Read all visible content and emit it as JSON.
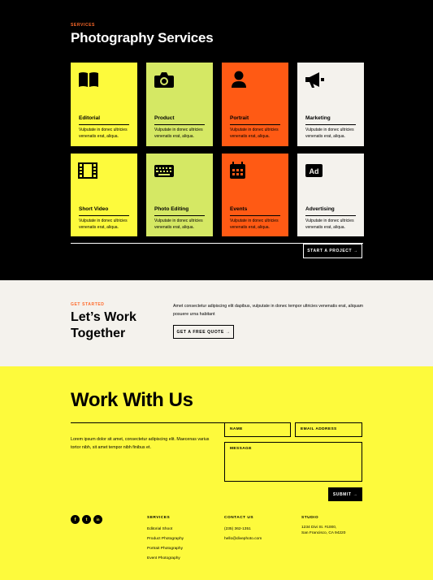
{
  "services": {
    "eyebrow": "SERVICES",
    "title": "Photography Services",
    "cards": [
      {
        "title": "Editorial",
        "desc": "Vulputate in donec ultricies venenatis erat, aliqua.",
        "icon": "book-icon",
        "color": "#fdfa3c"
      },
      {
        "title": "Product",
        "desc": "Vulputate in donec ultricies venenatis erat, aliqua.",
        "icon": "camera-icon",
        "color": "#d5e864"
      },
      {
        "title": "Portrait",
        "desc": "Vulputate in donec ultricies venenatis erat, aliqua.",
        "icon": "user-icon",
        "color": "#ff5a14"
      },
      {
        "title": "Marketing",
        "desc": "Vulputate in donec ultricies venenatis erat, aliqua.",
        "icon": "megaphone-icon",
        "color": "#f4f2ed"
      },
      {
        "title": "Short Video",
        "desc": "Vulputate in donec ultricies venenatis erat, aliqua.",
        "icon": "film-icon",
        "color": "#fdfa3c"
      },
      {
        "title": "Photo Editing",
        "desc": "Vulputate in donec ultricies venenatis erat, aliqua.",
        "icon": "keyboard-icon",
        "color": "#d5e864"
      },
      {
        "title": "Events",
        "desc": "Vulputate in donec ultricies venenatis erat, aliqua.",
        "icon": "calendar-icon",
        "color": "#ff5a14"
      },
      {
        "title": "Advertising",
        "desc": "Vulputate in donec ultricies venenatis erat, aliqua.",
        "icon": "ad-icon",
        "color": "#f4f2ed"
      }
    ],
    "cta_label": "START A PROJECT →"
  },
  "get_started": {
    "eyebrow": "GET STARTED",
    "title": "Let’s Work Together",
    "text": "Amet consectetur adipiscing elit dapibus, vulputate in donec tempor ultricies venenatis erat, aliquam posuere urna habitant",
    "button_label": "GET A FREE QUOTE →"
  },
  "work": {
    "title": "Work With Us",
    "intro": "Lorem ipsum dolor sit amet, consectetur adipiscing elit. Maecenas varius tortor nibh, sit amet tempor nibh finibus et.",
    "form": {
      "name_label": "NAME",
      "email_label": "EMAIL ADDRESS",
      "message_label": "MESSAGE",
      "submit_label": "SUBMIT →"
    }
  },
  "footer": {
    "socials": [
      {
        "icon": "facebook-icon",
        "glyph": "f"
      },
      {
        "icon": "twitter-icon",
        "glyph": "t"
      },
      {
        "icon": "linkedin-icon",
        "glyph": "in"
      }
    ],
    "services_heading": "SERVICES",
    "services_links": [
      "Editorial Shoot",
      "Product Photography",
      "Portrait Photography",
      "Event Photography"
    ],
    "contact_heading": "CONTACT US",
    "phone": "(235) 362-1351",
    "email": "hello@divephoto.com",
    "studio_heading": "STUDIO",
    "address_line1": "1234 Divi St. #1000,",
    "address_line2": "San Francisco, CA 94220"
  },
  "colors": {
    "black": "#000000",
    "yellow": "#fdfa3c",
    "lime": "#d5e864",
    "orange": "#ff5a14",
    "cream": "#f4f2ed",
    "accent": "#ff6a2a"
  }
}
